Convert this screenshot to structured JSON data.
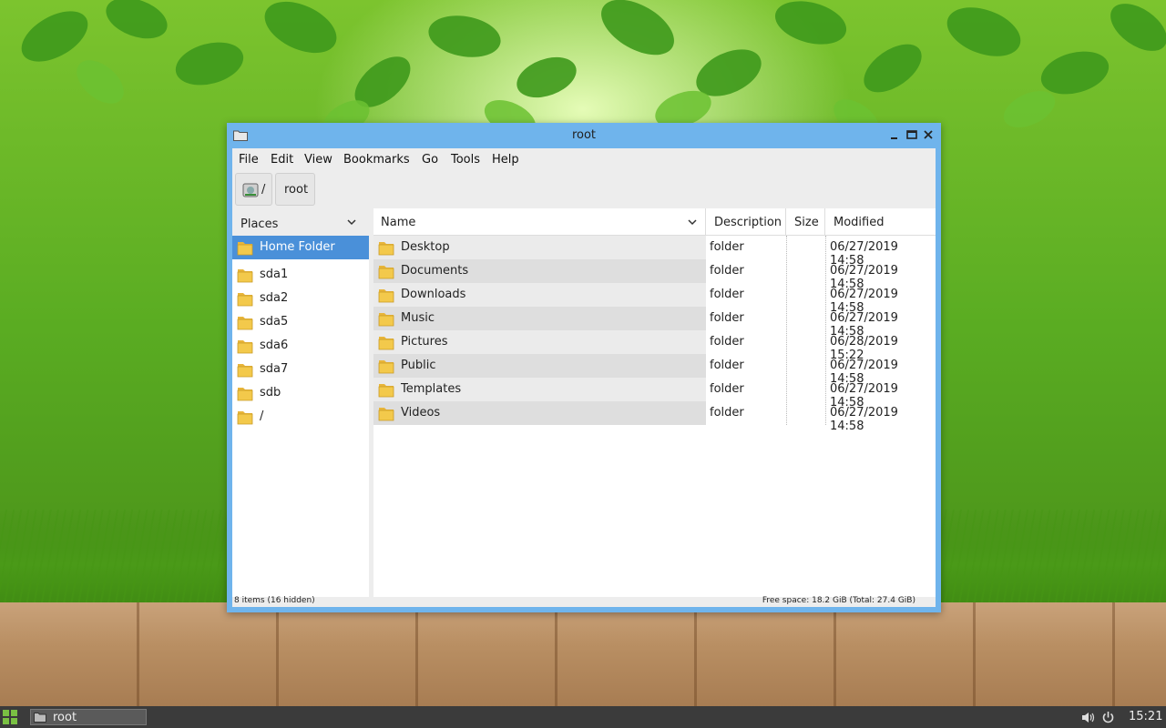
{
  "window": {
    "title": "root"
  },
  "menu": [
    "File",
    "Edit",
    "View",
    "Bookmarks",
    "Go",
    "Tools",
    "Help"
  ],
  "path": {
    "root_label": "/",
    "current": "root"
  },
  "places": {
    "header": "Places",
    "items": [
      "Home Folder",
      "sda1",
      "sda2",
      "sda5",
      "sda6",
      "sda7",
      "sdb",
      "/"
    ],
    "selected": 0
  },
  "columns": {
    "name": "Name",
    "description": "Description",
    "size": "Size",
    "modified": "Modified"
  },
  "files": [
    {
      "name": "Desktop",
      "description": "folder",
      "size": "",
      "modified": "06/27/2019 14:58"
    },
    {
      "name": "Documents",
      "description": "folder",
      "size": "",
      "modified": "06/27/2019 14:58"
    },
    {
      "name": "Downloads",
      "description": "folder",
      "size": "",
      "modified": "06/27/2019 14:58"
    },
    {
      "name": "Music",
      "description": "folder",
      "size": "",
      "modified": "06/27/2019 14:58"
    },
    {
      "name": "Pictures",
      "description": "folder",
      "size": "",
      "modified": "06/28/2019 15:22"
    },
    {
      "name": "Public",
      "description": "folder",
      "size": "",
      "modified": "06/27/2019 14:58"
    },
    {
      "name": "Templates",
      "description": "folder",
      "size": "",
      "modified": "06/27/2019 14:58"
    },
    {
      "name": "Videos",
      "description": "folder",
      "size": "",
      "modified": "06/27/2019 14:58"
    }
  ],
  "status": {
    "left": "8 items (16 hidden)",
    "right": "Free space: 18.2 GiB (Total: 27.4 GiB)"
  },
  "taskbar": {
    "task_label": "root",
    "clock": "15:21"
  },
  "colors": {
    "titlebar": "#6fb4ec",
    "selection": "#4a90d9",
    "folder": "#f3c94b",
    "taskbar": "#3b3b3b"
  },
  "icons": {
    "folder": "folder-icon",
    "start": "app-grid-icon",
    "volume": "volume-icon",
    "power": "power-icon",
    "drive": "drive-icon"
  }
}
